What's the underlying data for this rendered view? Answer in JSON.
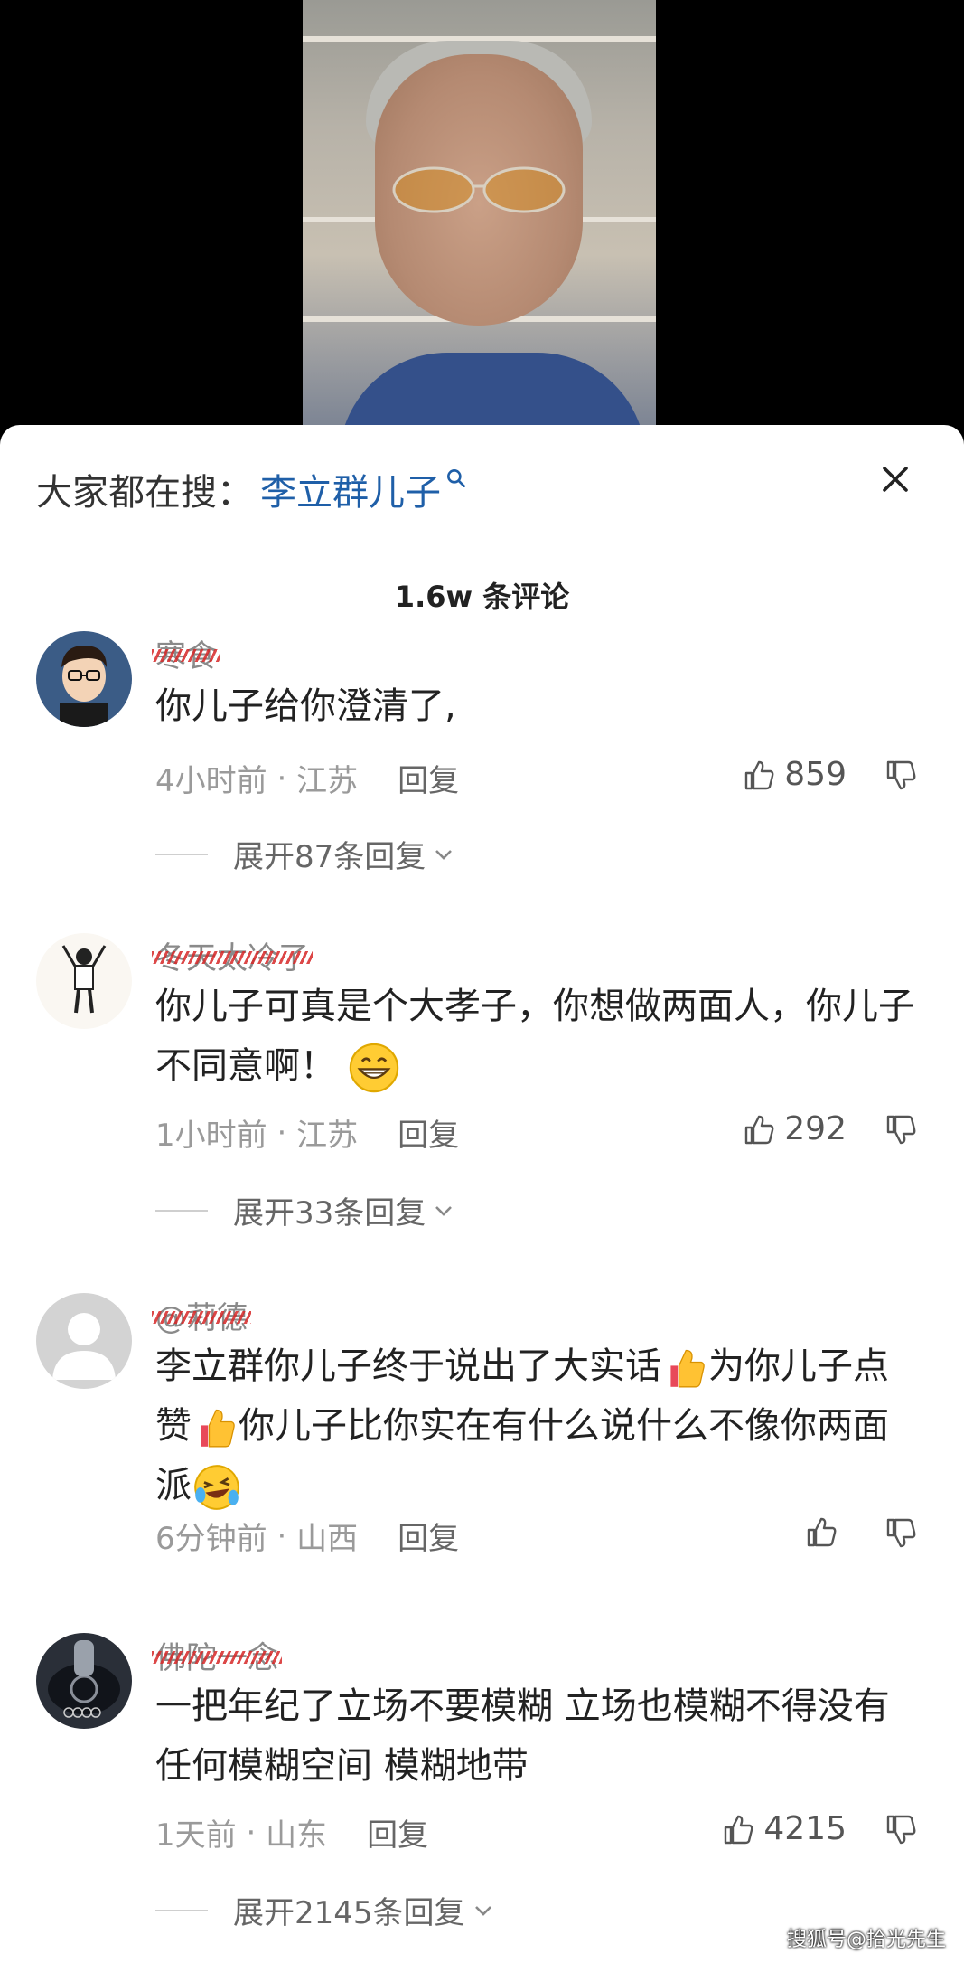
{
  "search": {
    "prefix": "大家都在搜：",
    "term": "李立群儿子"
  },
  "comment_count": "1.6w 条评论",
  "comments": [
    {
      "username": "寒食",
      "text": "你儿子给你澄清了,",
      "time": "4小时前",
      "location": "江苏",
      "reply_label": "回复",
      "likes": "859",
      "expand": "展开87条回复"
    },
    {
      "username": "冬天太冷了",
      "text": "你儿子可真是个大孝子，你想做两面人，你儿子不同意啊！",
      "time": "1小时前",
      "location": "江苏",
      "reply_label": "回复",
      "likes": "292",
      "expand": "展开33条回复"
    },
    {
      "username": "@莉德",
      "text_parts": [
        "李立群你儿子终于说出了大实话",
        "为你儿子点赞",
        "你儿子比你实在有什么说什么不像你两面派"
      ],
      "time": "6分钟前",
      "location": "山西",
      "reply_label": "回复",
      "likes": ""
    },
    {
      "username": "佛陀一念",
      "text": "一把年纪了立场不要模糊  立场也模糊不得没有任何模糊空间 模糊地带",
      "time": "1天前",
      "location": "山东",
      "reply_label": "回复",
      "likes": "4215",
      "expand": "展开2145条回复"
    }
  ],
  "watermark": "搜狐号@拾光先生",
  "colors": {
    "link": "#1f5fa8",
    "background": "#ffffff"
  }
}
